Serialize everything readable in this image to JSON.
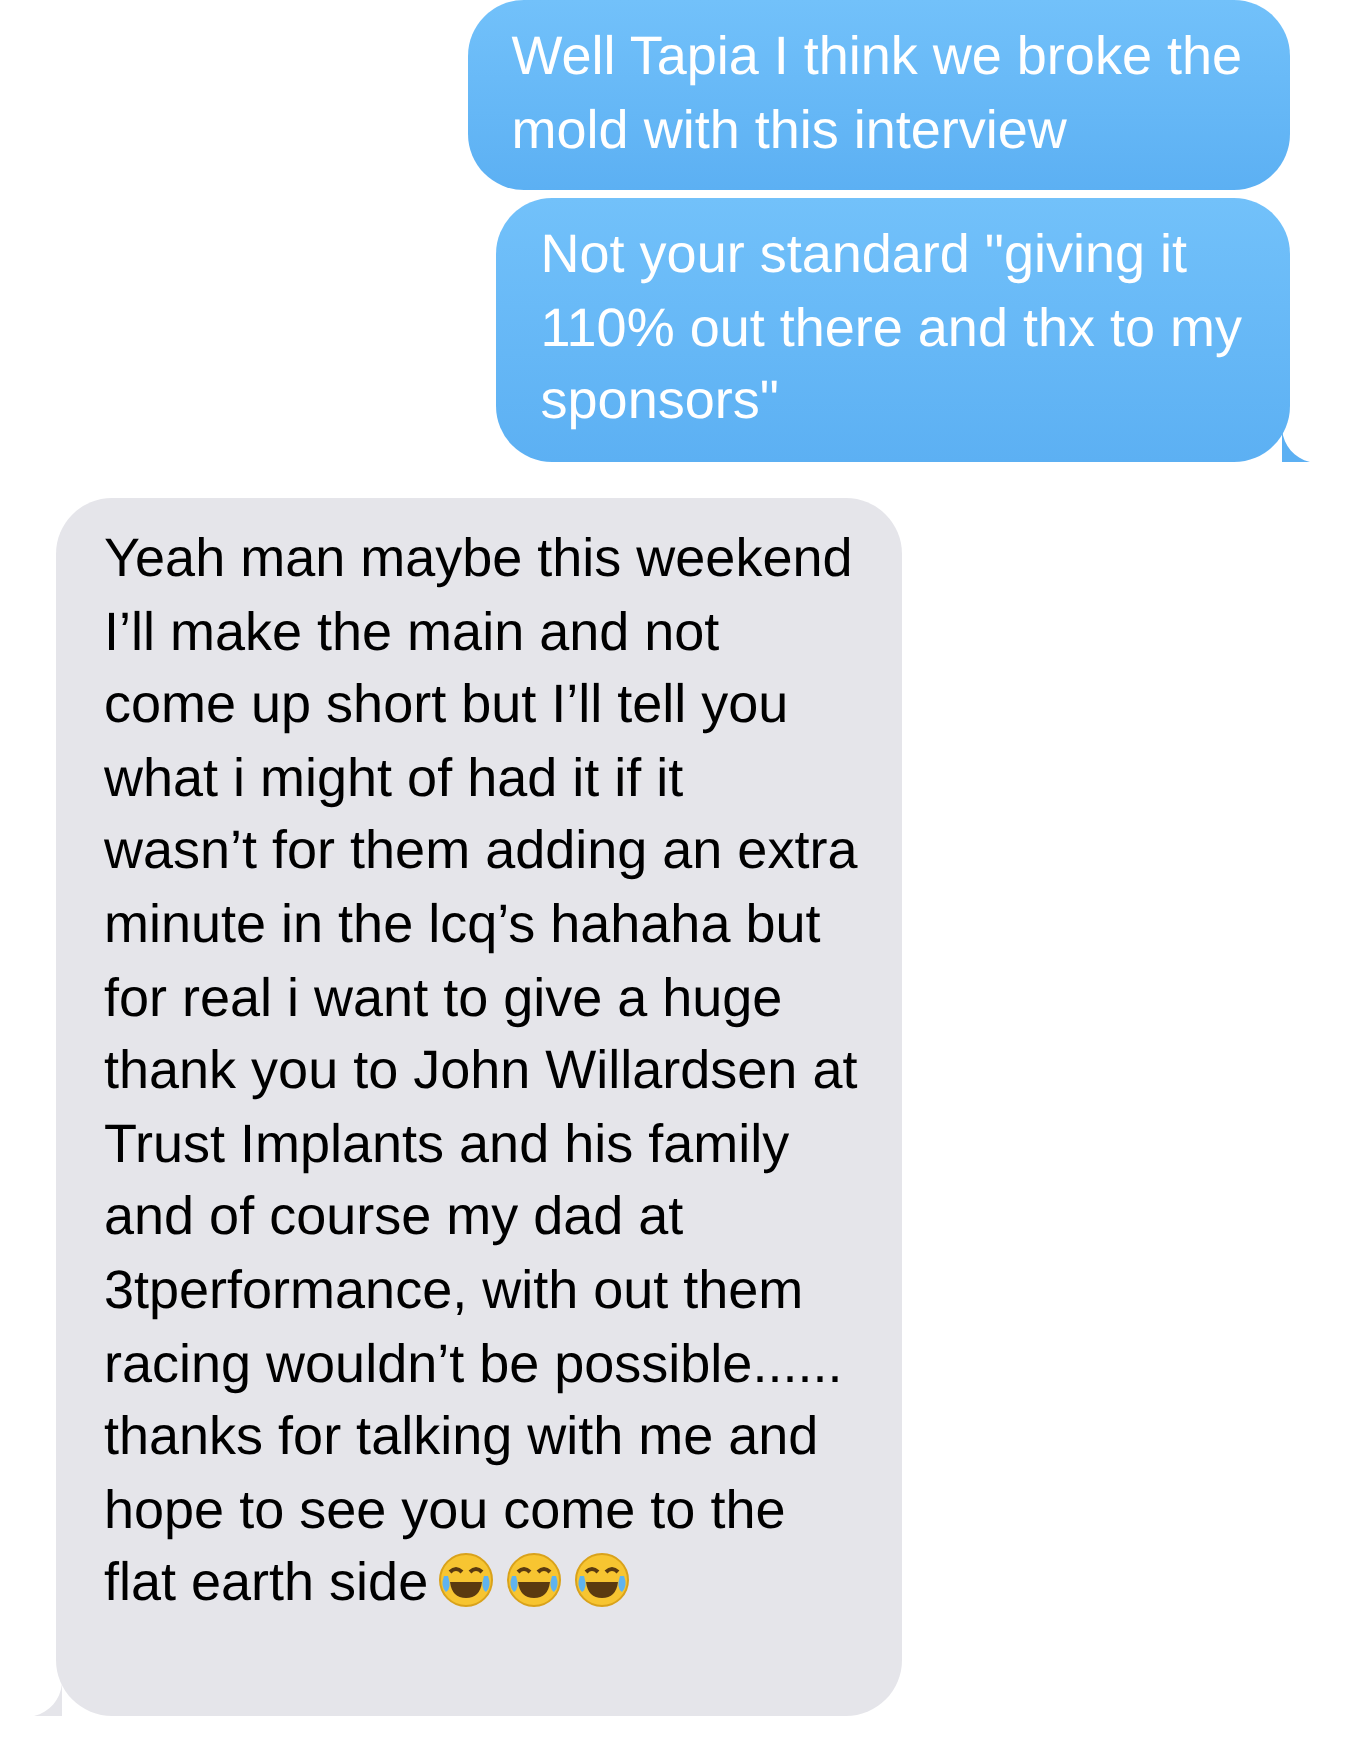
{
  "messages": [
    {
      "kind": "sent",
      "tail": false,
      "lines": [
        "Well Tapia I think we broke the",
        "mold with this interview"
      ]
    },
    {
      "kind": "sent",
      "tail": true,
      "lines": [
        "Not your standard \"giving it",
        "110% out there and thx to my",
        "sponsors\""
      ]
    },
    {
      "kind": "received",
      "tail": true,
      "lines": [
        "Yeah man maybe this weekend",
        "I’ll make the main and not",
        "come up short but I’ll tell you",
        "what i might of had it if it",
        "wasn’t for them adding an extra",
        "minute in the lcq’s hahaha but",
        "for real i want to give a huge",
        "thank you to John Willardsen at",
        "Trust Implants and his family",
        "and of course my dad at",
        "3tperformance, with out them",
        "racing wouldn’t be possible......",
        "thanks for talking with me and",
        "hope to see you come to the",
        "flat earth side"
      ]
    }
  ]
}
